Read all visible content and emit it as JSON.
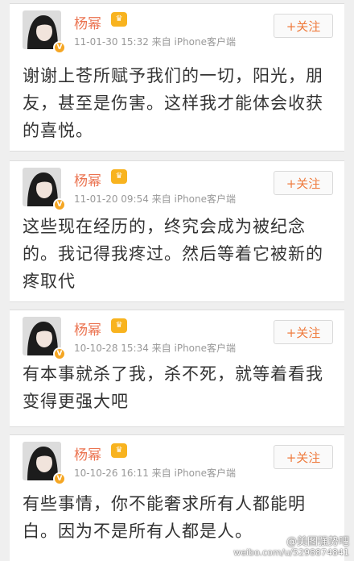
{
  "posts": [
    {
      "username": "杨幂",
      "meta": "11-01-30 15:32  来自 iPhone客户端",
      "follow_label": "+关注",
      "text": "谢谢上苍所赋予我们的一切，阳光，朋友，甚至是伤害。这样我才能体会收获的喜悦。"
    },
    {
      "username": "杨幂",
      "meta": "11-01-20 09:54  来自 iPhone客户端",
      "follow_label": "+关注",
      "text": "这些现在经历的，终究会成为被纪念的。我记得我疼过。然后等着它被新的疼取代"
    },
    {
      "username": "杨幂",
      "meta": "10-10-28 15:34  来自 iPhone客户端",
      "follow_label": "+关注",
      "text": "有本事就杀了我，杀不死，就等着看我变得更强大吧"
    },
    {
      "username": "杨幂",
      "meta": "10-10-26 16:11  来自 iPhone客户端",
      "follow_label": "+关注",
      "text": "有些事情，你不能奢求所有人都能明白。因为不是所有人都是人。"
    }
  ],
  "icons": {
    "verified": "verified-badge-icon",
    "vip": "vip-crown-icon"
  },
  "colors": {
    "username": "#eb7350",
    "follow_text": "#ef7b3d",
    "verified": "#f5a623",
    "meta": "#999999"
  },
  "watermark": {
    "name": "@美图强势吧",
    "url": "weibo.com/u/5298874841"
  }
}
